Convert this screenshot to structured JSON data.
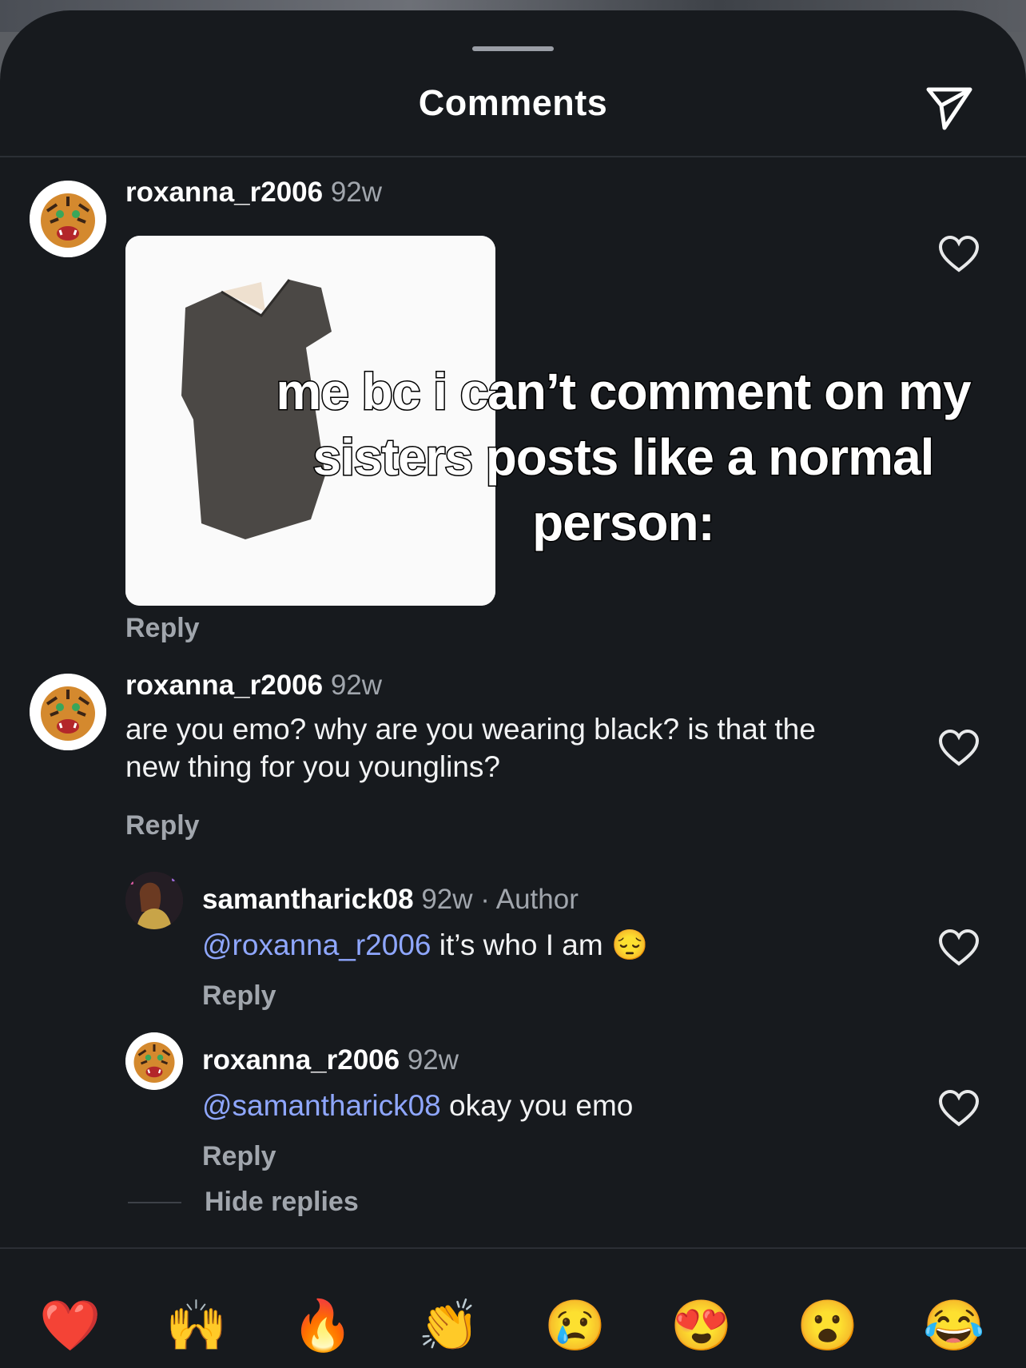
{
  "header": {
    "title": "Comments",
    "send_icon": "paper-plane-icon"
  },
  "comments": [
    {
      "username": "roxanna_r2006",
      "age": "92w",
      "media_caption": "me bc i can’t comment on my sisters posts like a normal person:",
      "reply_label": "Reply"
    },
    {
      "username": "roxanna_r2006",
      "age": "92w",
      "text": "are you emo? why are you wearing black? is that the new thing for you younglins?",
      "reply_label": "Reply"
    }
  ],
  "replies": [
    {
      "username": "samantharick08",
      "age": "92w · Author",
      "mention": "@roxanna_r2006",
      "text": " it’s who I am 😔",
      "reply_label": "Reply"
    },
    {
      "username": "roxanna_r2006",
      "age": "92w",
      "mention": "@samantharick08",
      "text": " okay you emo",
      "reply_label": "Reply"
    }
  ],
  "hide_replies_label": "Hide replies",
  "emoji_bar": [
    "❤️",
    "🙌",
    "🔥",
    "👏",
    "😢",
    "😍",
    "😮",
    "😂"
  ],
  "colors": {
    "background": "#171a1e",
    "mention": "#8fa7ff",
    "secondary_text": "#a1a6ad"
  }
}
